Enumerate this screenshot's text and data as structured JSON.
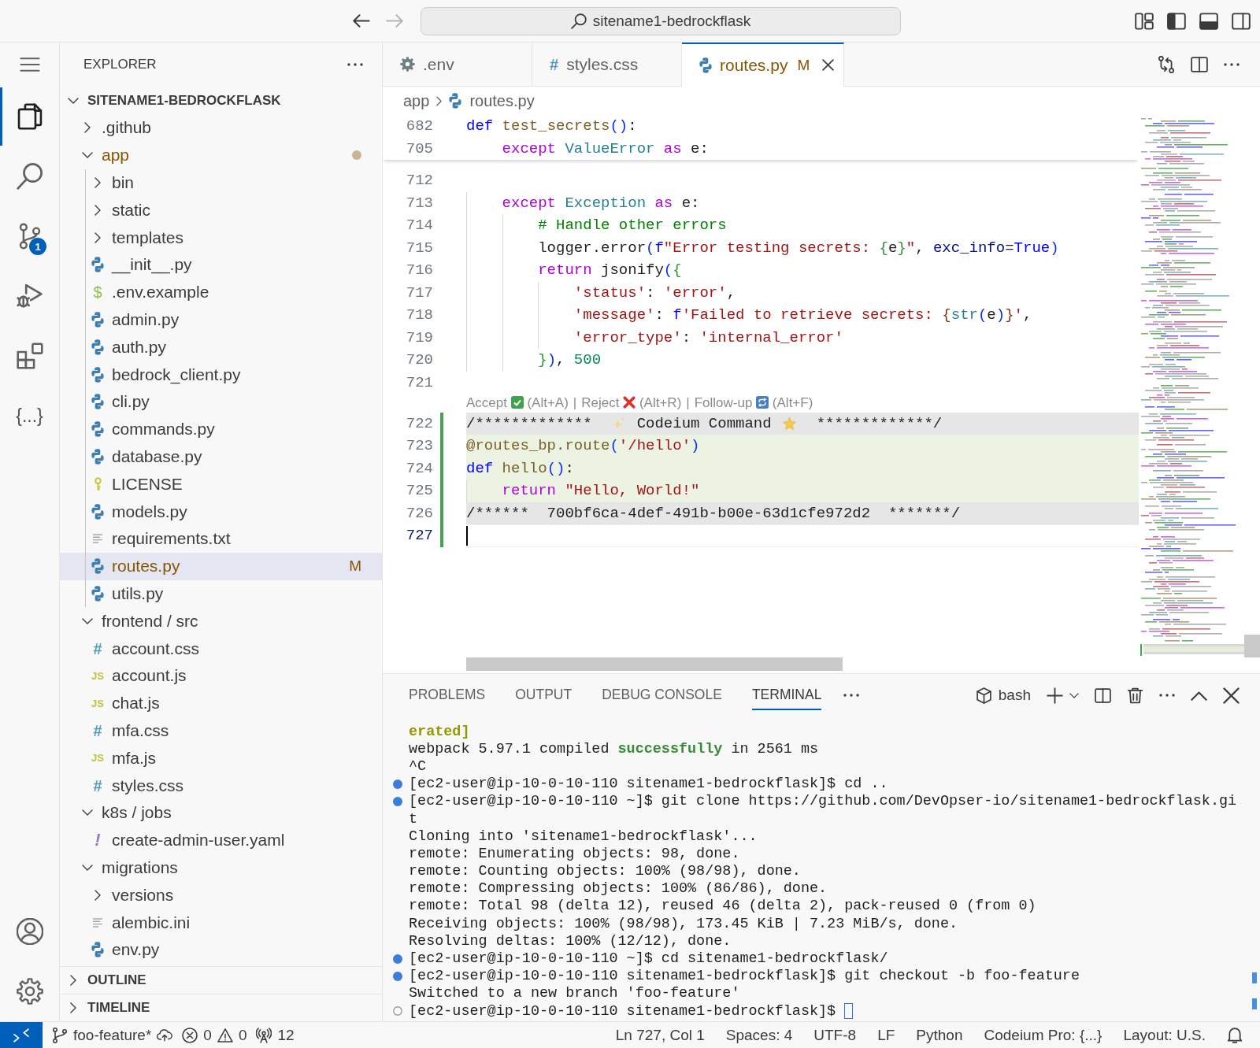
{
  "title_bar": {
    "nav": [
      {
        "kind": "back",
        "disabled": false
      },
      {
        "kind": "forward",
        "disabled": true
      }
    ],
    "search": "sitename1-bedrockflask",
    "layout_toggles": [
      {
        "kind": "primary-sidebar",
        "on": true
      },
      {
        "kind": "panel",
        "on": true
      },
      {
        "kind": "secondary-sidebar",
        "on": false
      }
    ]
  },
  "activity_bar": {
    "items": [
      {
        "kind": "explorer",
        "selected": true
      },
      {
        "kind": "search",
        "selected": false
      },
      {
        "kind": "source-control",
        "selected": false,
        "badge": "1"
      },
      {
        "kind": "run-debug",
        "selected": false
      },
      {
        "kind": "extensions",
        "selected": false
      },
      {
        "kind": "codeium",
        "selected": false,
        "glyph": "{...}"
      }
    ],
    "bottom": [
      {
        "kind": "accounts"
      },
      {
        "kind": "settings"
      }
    ]
  },
  "sidebar": {
    "title": "EXPLORER",
    "tree": {
      "label": "SITENAME1-BEDROCKFLASK",
      "expanded": true,
      "children": [
        {
          "label": ".github",
          "kind": "folder",
          "expanded": false,
          "selected": false,
          "modified": false
        },
        {
          "label": "app",
          "kind": "folder",
          "expanded": true,
          "selected": false,
          "modified": true,
          "children": [
            {
              "label": "bin",
              "kind": "folder",
              "expanded": false,
              "selected": false,
              "modified": false
            },
            {
              "label": "static",
              "kind": "folder",
              "expanded": false,
              "selected": false,
              "modified": false
            },
            {
              "label": "templates",
              "kind": "folder",
              "expanded": false,
              "selected": false,
              "modified": false
            },
            {
              "label": "__init__.py",
              "kind": "python",
              "selected": false,
              "modified": false
            },
            {
              "label": ".env.example",
              "kind": "env",
              "glyph": "$",
              "selected": false,
              "modified": false
            },
            {
              "label": "admin.py",
              "kind": "python",
              "selected": false,
              "modified": false
            },
            {
              "label": "auth.py",
              "kind": "python",
              "selected": false,
              "modified": false
            },
            {
              "label": "bedrock_client.py",
              "kind": "python",
              "selected": false,
              "modified": false
            },
            {
              "label": "cli.py",
              "kind": "python",
              "selected": false,
              "modified": false
            },
            {
              "label": "commands.py",
              "kind": "python",
              "selected": false,
              "modified": false
            },
            {
              "label": "database.py",
              "kind": "python",
              "selected": false,
              "modified": false
            },
            {
              "label": "LICENSE",
              "kind": "license",
              "selected": false,
              "modified": false
            },
            {
              "label": "models.py",
              "kind": "python",
              "selected": false,
              "modified": false
            },
            {
              "label": "requirements.txt",
              "kind": "text",
              "selected": false,
              "modified": false
            },
            {
              "label": "routes.py",
              "kind": "python",
              "selected": true,
              "modified": true,
              "badge": "M"
            },
            {
              "label": "utils.py",
              "kind": "python",
              "selected": false,
              "modified": false
            }
          ]
        },
        {
          "label": "frontend / src",
          "kind": "folder",
          "expanded": true,
          "selected": false,
          "modified": false,
          "children": [
            {
              "label": "account.css",
              "kind": "css",
              "glyph": "#",
              "selected": false,
              "modified": false
            },
            {
              "label": "account.js",
              "kind": "js",
              "glyph": "JS",
              "selected": false,
              "modified": false
            },
            {
              "label": "chat.js",
              "kind": "js",
              "glyph": "JS",
              "selected": false,
              "modified": false
            },
            {
              "label": "mfa.css",
              "kind": "css",
              "glyph": "#",
              "selected": false,
              "modified": false
            },
            {
              "label": "mfa.js",
              "kind": "js",
              "glyph": "JS",
              "selected": false,
              "modified": false
            },
            {
              "label": "styles.css",
              "kind": "css",
              "glyph": "#",
              "selected": false,
              "modified": false
            }
          ]
        },
        {
          "label": "k8s / jobs",
          "kind": "folder",
          "expanded": true,
          "selected": false,
          "modified": false,
          "children": [
            {
              "label": "create-admin-user.yaml",
              "kind": "yaml",
              "glyph": "!",
              "selected": false,
              "modified": false
            }
          ]
        },
        {
          "label": "migrations",
          "kind": "folder",
          "expanded": true,
          "selected": false,
          "modified": false,
          "children": [
            {
              "label": "versions",
              "kind": "folder",
              "expanded": false,
              "selected": false,
              "modified": false
            },
            {
              "label": "alembic.ini",
              "kind": "text",
              "selected": false,
              "modified": false
            },
            {
              "label": "env.py",
              "kind": "python",
              "selected": false,
              "modified": false
            }
          ]
        }
      ]
    },
    "sections": [
      {
        "label": "OUTLINE",
        "expanded": false
      },
      {
        "label": "TIMELINE",
        "expanded": false
      }
    ]
  },
  "editor": {
    "tabs": [
      {
        "label": ".env",
        "kind": "settings",
        "selected": false,
        "modified": false
      },
      {
        "label": "styles.css",
        "kind": "css",
        "glyph": "#",
        "selected": false,
        "modified": false
      },
      {
        "label": "routes.py",
        "kind": "python",
        "selected": true,
        "modified": true,
        "badge": "M"
      }
    ],
    "breadcrumb": [
      {
        "label": "app",
        "kind": "folder"
      },
      {
        "label": "routes.py",
        "kind": "python"
      }
    ],
    "sticky_lines": [
      {
        "number": "682",
        "tokens": [
          {
            "kind": "keyword",
            "text": "def"
          },
          {
            "kind": "function",
            "text": " test_secrets"
          },
          {
            "kind": "bracket",
            "text": "()"
          },
          {
            "kind": "plain",
            "text": ":"
          }
        ]
      },
      {
        "number": "705",
        "tokens": [
          {
            "kind": "control",
            "text": "    except"
          },
          {
            "kind": "class",
            "text": " ValueError"
          },
          {
            "kind": "control",
            "text": " as"
          },
          {
            "kind": "plain",
            "text": " e:"
          }
        ]
      }
    ],
    "lines": [
      {
        "number": "712",
        "kind": "code",
        "added": false,
        "inserted": false,
        "marker": false,
        "cursor": false
      },
      {
        "number": "713",
        "kind": "code",
        "added": false,
        "inserted": false,
        "marker": false,
        "cursor": false,
        "tokens": [
          {
            "kind": "control",
            "text": "    except"
          },
          {
            "kind": "class",
            "text": " Exception"
          },
          {
            "kind": "control",
            "text": " as"
          },
          {
            "kind": "plain",
            "text": " e:"
          }
        ]
      },
      {
        "number": "714",
        "kind": "code",
        "added": false,
        "inserted": false,
        "marker": false,
        "cursor": false,
        "tokens": [
          {
            "kind": "comment",
            "text": "        # Handle other errors"
          }
        ]
      },
      {
        "number": "715",
        "kind": "code",
        "added": false,
        "inserted": false,
        "marker": false,
        "cursor": false,
        "tokens": [
          {
            "kind": "plain",
            "text": "        logger.error"
          },
          {
            "kind": "bracket",
            "text": "("
          },
          {
            "kind": "keyword",
            "text": "f"
          },
          {
            "kind": "string",
            "text": "\"Error testing secrets: "
          },
          {
            "kind": "bracket2",
            "text": "{"
          },
          {
            "kind": "plain",
            "text": "e"
          },
          {
            "kind": "bracket2",
            "text": "}"
          },
          {
            "kind": "string",
            "text": "\""
          },
          {
            "kind": "plain",
            "text": ", "
          },
          {
            "kind": "param",
            "text": "exc_info"
          },
          {
            "kind": "plain",
            "text": "="
          },
          {
            "kind": "keyword",
            "text": "True"
          },
          {
            "kind": "bracket",
            "text": ")"
          }
        ]
      },
      {
        "number": "716",
        "kind": "code",
        "added": false,
        "inserted": false,
        "marker": false,
        "cursor": false,
        "tokens": [
          {
            "kind": "control",
            "text": "        return"
          },
          {
            "kind": "plain",
            "text": " jsonify"
          },
          {
            "kind": "bracket",
            "text": "("
          },
          {
            "kind": "bracket2",
            "text": "{"
          }
        ]
      },
      {
        "number": "717",
        "kind": "code",
        "added": false,
        "inserted": false,
        "marker": false,
        "cursor": false,
        "tokens": [
          {
            "kind": "string",
            "text": "            'status'"
          },
          {
            "kind": "plain",
            "text": ": "
          },
          {
            "kind": "string",
            "text": "'error'"
          },
          {
            "kind": "plain",
            "text": ","
          }
        ]
      },
      {
        "number": "718",
        "kind": "code",
        "added": false,
        "inserted": false,
        "marker": false,
        "cursor": false,
        "tokens": [
          {
            "kind": "string",
            "text": "            'message'"
          },
          {
            "kind": "plain",
            "text": ": "
          },
          {
            "kind": "keyword",
            "text": "f"
          },
          {
            "kind": "string",
            "text": "'Failed to retrieve secrets: "
          },
          {
            "kind": "bracket3",
            "text": "{"
          },
          {
            "kind": "class",
            "text": "str"
          },
          {
            "kind": "bracket",
            "text": "("
          },
          {
            "kind": "plain",
            "text": "e"
          },
          {
            "kind": "bracket",
            "text": ")"
          },
          {
            "kind": "bracket3",
            "text": "}"
          },
          {
            "kind": "string",
            "text": "'"
          },
          {
            "kind": "plain",
            "text": ","
          }
        ]
      },
      {
        "number": "719",
        "kind": "code",
        "added": false,
        "inserted": false,
        "marker": false,
        "cursor": false,
        "tokens": [
          {
            "kind": "string",
            "text": "            'error_type'"
          },
          {
            "kind": "plain",
            "text": ": "
          },
          {
            "kind": "string",
            "text": "'internal_error'"
          }
        ]
      },
      {
        "number": "720",
        "kind": "code",
        "added": false,
        "inserted": false,
        "marker": false,
        "cursor": false,
        "tokens": [
          {
            "kind": "bracket2",
            "text": "        }"
          },
          {
            "kind": "bracket",
            "text": ")"
          },
          {
            "kind": "plain",
            "text": ", "
          },
          {
            "kind": "number",
            "text": "500"
          }
        ]
      },
      {
        "number": "721",
        "kind": "code",
        "added": false,
        "inserted": false,
        "marker": false,
        "cursor": false
      },
      {
        "kind": "codelens",
        "separator": "|",
        "actions": [
          {
            "kind": "accept",
            "label": "Accept",
            "shortcut": "(Alt+A)"
          },
          {
            "kind": "reject",
            "label": "Reject",
            "shortcut": "(Alt+R)"
          },
          {
            "kind": "follow-up",
            "label": "Follow-up",
            "shortcut": "(Alt+F)"
          }
        ]
      },
      {
        "number": "722",
        "kind": "banner",
        "added": true,
        "inserted": false,
        "marker": true,
        "cursor": false,
        "left": "/*************",
        "label": "Codeium Command",
        "right": "*************/"
      },
      {
        "number": "723",
        "kind": "code",
        "added": true,
        "inserted": true,
        "marker": false,
        "cursor": false,
        "tokens": [
          {
            "kind": "function",
            "text": "@routes_bp.route"
          },
          {
            "kind": "bracket",
            "text": "("
          },
          {
            "kind": "string",
            "text": "'/hello'"
          },
          {
            "kind": "bracket",
            "text": ")"
          }
        ]
      },
      {
        "number": "724",
        "kind": "code",
        "added": true,
        "inserted": true,
        "marker": false,
        "cursor": false,
        "tokens": [
          {
            "kind": "keyword",
            "text": "def"
          },
          {
            "kind": "function",
            "text": " hello"
          },
          {
            "kind": "bracket",
            "text": "()"
          },
          {
            "kind": "plain",
            "text": ":"
          }
        ]
      },
      {
        "number": "725",
        "kind": "code",
        "added": true,
        "inserted": true,
        "marker": false,
        "cursor": false,
        "tokens": [
          {
            "kind": "control",
            "text": "    return"
          },
          {
            "kind": "string",
            "text": " \"Hello, World!\""
          }
        ]
      },
      {
        "number": "726",
        "kind": "code",
        "added": true,
        "inserted": false,
        "marker": true,
        "cursor": false,
        "tokens": [
          {
            "kind": "plain",
            "text": "/******  700bf6ca-4def-491b-b00e-63d1cfe972d2  *******/"
          }
        ]
      },
      {
        "number": "727",
        "kind": "code",
        "added": true,
        "inserted": false,
        "marker": false,
        "cursor": true
      }
    ]
  },
  "panel": {
    "tabs": [
      {
        "label": "PROBLEMS",
        "selected": false
      },
      {
        "label": "OUTPUT",
        "selected": false
      },
      {
        "label": "DEBUG CONSOLE",
        "selected": false
      },
      {
        "label": "TERMINAL",
        "selected": true
      }
    ],
    "terminal": {
      "shell": "bash",
      "lines": [
        {
          "kind": "output",
          "cursor": false,
          "segments": [
            {
              "kind": "warning",
              "text": "erated]"
            }
          ]
        },
        {
          "kind": "output",
          "cursor": false,
          "segments": [
            {
              "kind": "plain",
              "text": "webpack 5.97.1 compiled "
            },
            {
              "kind": "success",
              "text": "successfully"
            },
            {
              "kind": "plain",
              "text": " in 2561 ms"
            }
          ]
        },
        {
          "kind": "output",
          "cursor": false,
          "segments": [
            {
              "kind": "plain",
              "text": "^C"
            }
          ]
        },
        {
          "kind": "command",
          "cursor": false,
          "segments": [
            {
              "kind": "plain",
              "text": "[ec2-user@ip-10-0-10-110 sitename1-bedrockflask]$ cd .."
            }
          ]
        },
        {
          "kind": "command",
          "cursor": false,
          "segments": [
            {
              "kind": "plain",
              "text": "[ec2-user@ip-10-0-10-110 ~]$ git clone https://github.com/DevOpser-io/sitename1-bedrockflask.gi"
            }
          ]
        },
        {
          "kind": "output",
          "cursor": false,
          "segments": [
            {
              "kind": "plain",
              "text": "t"
            }
          ]
        },
        {
          "kind": "output",
          "cursor": false,
          "segments": [
            {
              "kind": "plain",
              "text": "Cloning into 'sitename1-bedrockflask'..."
            }
          ]
        },
        {
          "kind": "output",
          "cursor": false,
          "segments": [
            {
              "kind": "plain",
              "text": "remote: Enumerating objects: 98, done."
            }
          ]
        },
        {
          "kind": "output",
          "cursor": false,
          "segments": [
            {
              "kind": "plain",
              "text": "remote: Counting objects: 100% (98/98), done."
            }
          ]
        },
        {
          "kind": "output",
          "cursor": false,
          "segments": [
            {
              "kind": "plain",
              "text": "remote: Compressing objects: 100% (86/86), done."
            }
          ]
        },
        {
          "kind": "output",
          "cursor": false,
          "segments": [
            {
              "kind": "plain",
              "text": "remote: Total 98 (delta 12), reused 46 (delta 2), pack-reused 0 (from 0)"
            }
          ]
        },
        {
          "kind": "output",
          "cursor": false,
          "segments": [
            {
              "kind": "plain",
              "text": "Receiving objects: 100% (98/98), 173.45 KiB | 7.23 MiB/s, done."
            }
          ]
        },
        {
          "kind": "output",
          "cursor": false,
          "segments": [
            {
              "kind": "plain",
              "text": "Resolving deltas: 100% (12/12), done."
            }
          ]
        },
        {
          "kind": "command",
          "cursor": false,
          "segments": [
            {
              "kind": "plain",
              "text": "[ec2-user@ip-10-0-10-110 ~]$ cd sitename1-bedrockflask/"
            }
          ]
        },
        {
          "kind": "command",
          "cursor": false,
          "segments": [
            {
              "kind": "plain",
              "text": "[ec2-user@ip-10-0-10-110 sitename1-bedrockflask]$ git checkout -b foo-feature"
            }
          ]
        },
        {
          "kind": "output",
          "cursor": false,
          "segments": [
            {
              "kind": "plain",
              "text": "Switched to a new branch 'foo-feature'"
            }
          ]
        },
        {
          "kind": "prompt",
          "cursor": true,
          "segments": [
            {
              "kind": "plain",
              "text": "[ec2-user@ip-10-0-10-110 sitename1-bedrockflask]$"
            }
          ]
        }
      ]
    }
  },
  "status_bar": {
    "branch": "foo-feature*",
    "errors": "0",
    "warnings": "0",
    "ports": "12",
    "items": [
      "Ln 727, Col 1",
      "Spaces: 4",
      "UTF-8",
      "LF",
      "Python",
      "Codeium Pro: {...}",
      "Layout: U.S."
    ]
  }
}
